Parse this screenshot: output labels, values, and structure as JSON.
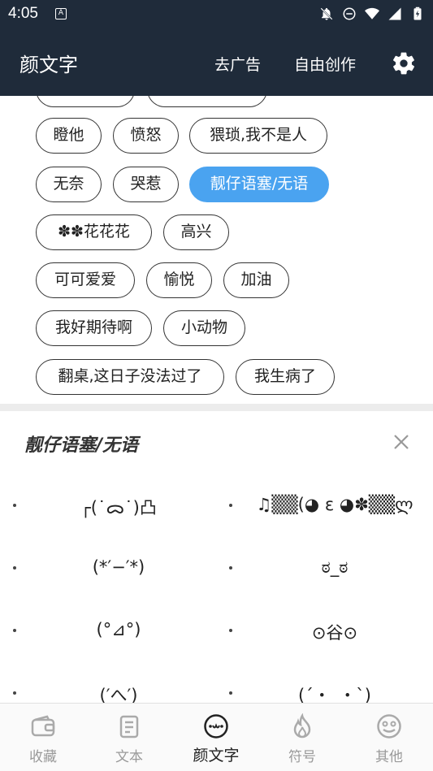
{
  "status_bar": {
    "time": "4:05",
    "a_badge": "A",
    "icons": [
      "notifications-off-icon",
      "do-not-disturb-icon",
      "wifi-icon",
      "signal-icon",
      "battery-charging-icon"
    ]
  },
  "app_bar": {
    "title": "颜文字",
    "remove_ads": "去广告",
    "free_create": "自由创作",
    "settings_icon": "gear-icon"
  },
  "tags": [
    {
      "label": "瞪他",
      "selected": false
    },
    {
      "label": "愤怒",
      "selected": false
    },
    {
      "label": "猥琐,我不是人",
      "selected": false
    },
    {
      "label": "无奈",
      "selected": false
    },
    {
      "label": "哭惹",
      "selected": false
    },
    {
      "label": "靓仔语塞/无语",
      "selected": true
    },
    {
      "label": "✽✽花花花",
      "selected": false
    },
    {
      "label": "高兴",
      "selected": false
    },
    {
      "label": "可可爱爱",
      "selected": false
    },
    {
      "label": "愉悦",
      "selected": false
    },
    {
      "label": "加油",
      "selected": false
    },
    {
      "label": "我好期待啊",
      "selected": false
    },
    {
      "label": "小动物",
      "selected": false
    },
    {
      "label": "翻桌,这日子没法过了",
      "selected": false
    },
    {
      "label": "我生病了",
      "selected": false
    }
  ],
  "colors": {
    "header_bg": "#1f2b3a",
    "selected_tag": "#4aa3f0"
  },
  "panel": {
    "title": "靓仔语塞/无语",
    "close_icon": "close-icon",
    "emoticons": [
      "┌(˙ᯅ˙)凸",
      "♫▒▒(◕ ε ◕✽▒▒ლ",
      "(*′−′*)",
      "ಠ_ಠ",
      "(°⊿°)",
      "⊙谷⊙",
      "(′へ′)",
      "(´・_・`)"
    ]
  },
  "bottom_nav": [
    {
      "label": "收藏",
      "icon": "wallet-icon",
      "active": false
    },
    {
      "label": "文本",
      "icon": "document-icon",
      "active": false
    },
    {
      "label": "颜文字",
      "icon": "emoticon-face-icon",
      "active": true
    },
    {
      "label": "符号",
      "icon": "fire-icon",
      "active": false
    },
    {
      "label": "其他",
      "icon": "face-mask-icon",
      "active": false
    }
  ]
}
